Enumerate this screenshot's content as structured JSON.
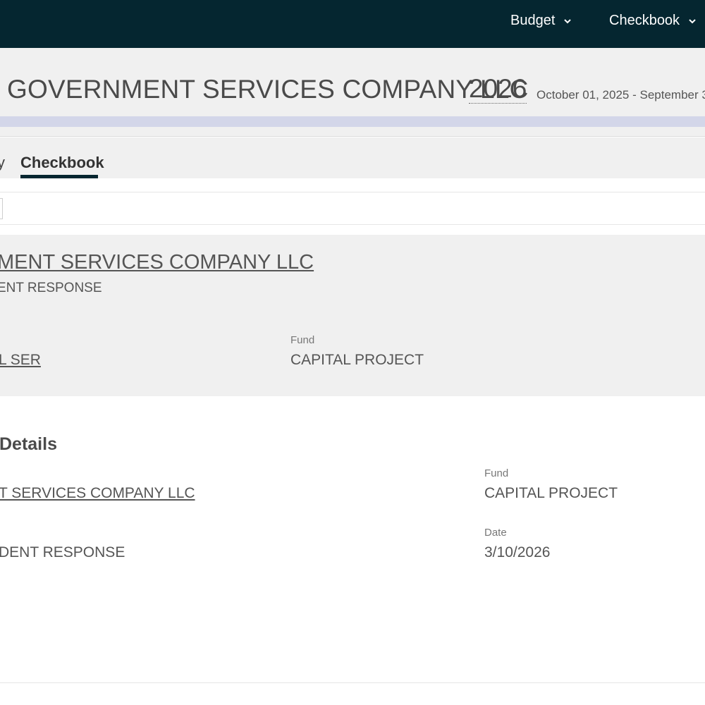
{
  "nav": {
    "items": [
      {
        "label": "Budget",
        "icon": "chevron-down-icon"
      },
      {
        "label": "Checkbook",
        "icon": "chevron-down-icon"
      }
    ],
    "background": "#052630"
  },
  "header": {
    "title": "GOVERNMENT SERVICES COMPANY LLC",
    "year": "2026",
    "date_range": "October 01, 2025 - September 3"
  },
  "tabs": {
    "partial_tab_label": "y",
    "active_tab_label": "Checkbook"
  },
  "summary": {
    "vendor": "MENT SERVICES COMPANY LLC",
    "agency": "ENT RESPONSE",
    "department": "L SER",
    "fund_label": "Fund",
    "fund_value": "CAPITAL PROJECT"
  },
  "details": {
    "heading": "Details",
    "vendor": "T SERVICES COMPANY LLC",
    "agency": "DENT RESPONSE",
    "fund_label": "Fund",
    "fund_value": "CAPITAL PROJECT",
    "date_label": "Date",
    "date_value": "3/10/2026"
  },
  "colors": {
    "accent_strip": "#d3d6e9",
    "panel_bg": "#f0f0f0"
  }
}
